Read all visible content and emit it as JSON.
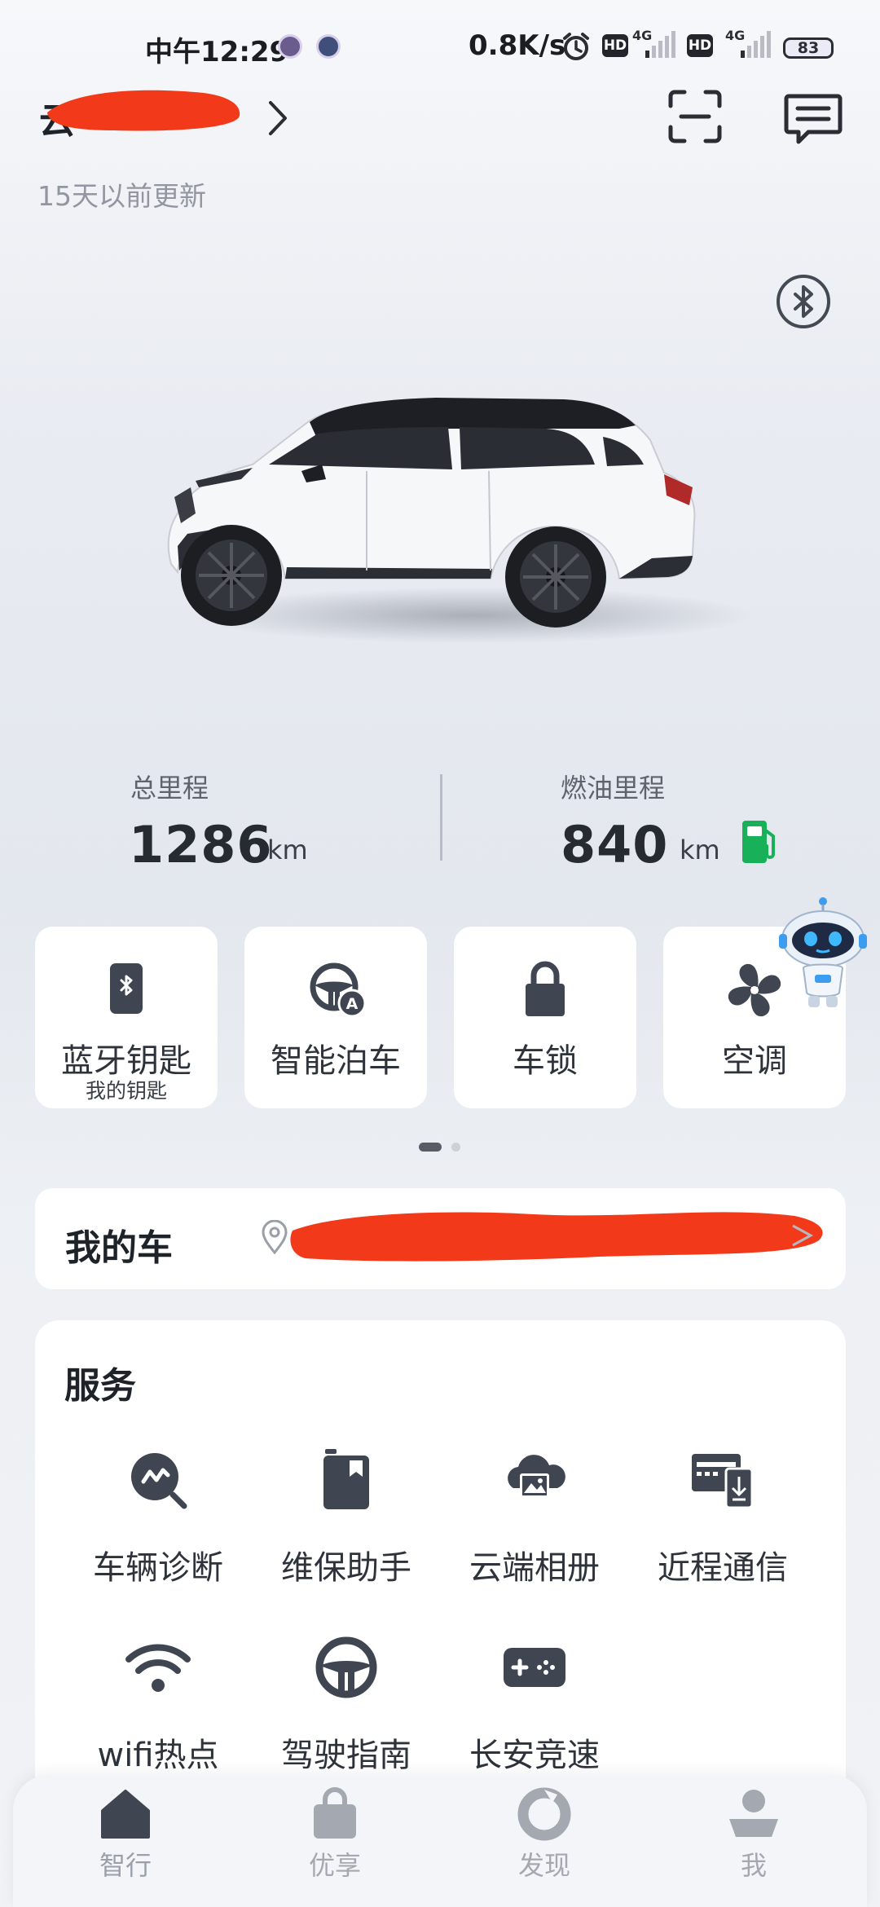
{
  "status_bar": {
    "time": "中午12:29",
    "speed": "0.8K/s",
    "hd1": "HD",
    "net1": "4G",
    "hd2": "HD",
    "net2": "4G",
    "battery": "83"
  },
  "header": {
    "car_name": "云",
    "updated": "15天以前更新"
  },
  "stats": {
    "total_label": "总里程",
    "total_value": "1286",
    "total_unit": "km",
    "fuel_label": "燃油里程",
    "fuel_value": "840",
    "fuel_unit": "km"
  },
  "quick_actions": [
    {
      "label": "蓝牙钥匙",
      "sub": "我的钥匙",
      "icon": "bluetooth-key-icon"
    },
    {
      "label": "智能泊车",
      "sub": "",
      "icon": "auto-parking-icon"
    },
    {
      "label": "车锁",
      "sub": "",
      "icon": "lock-icon"
    },
    {
      "label": "空调",
      "sub": "",
      "icon": "fan-icon"
    }
  ],
  "pager": {
    "count": 2,
    "active": 0
  },
  "my_car": {
    "title": "我的车"
  },
  "services": {
    "title": "服务",
    "items": [
      {
        "label": "车辆诊断",
        "icon": "diagnosis-icon"
      },
      {
        "label": "维保助手",
        "icon": "maintenance-icon"
      },
      {
        "label": "云端相册",
        "icon": "cloud-album-icon"
      },
      {
        "label": "近程通信",
        "icon": "near-communication-icon"
      },
      {
        "label": "wifi热点",
        "icon": "wifi-icon"
      },
      {
        "label": "驾驶指南",
        "icon": "steering-wheel-icon"
      },
      {
        "label": "长安竞速",
        "icon": "gamepad-icon"
      }
    ]
  },
  "bottom_nav": [
    {
      "label": "智行",
      "icon": "home-icon",
      "active": true
    },
    {
      "label": "优享",
      "icon": "shopping-bag-icon",
      "active": false
    },
    {
      "label": "发现",
      "icon": "discover-icon",
      "active": false
    },
    {
      "label": "我",
      "icon": "profile-icon",
      "active": false
    }
  ],
  "colors": {
    "accent_dark": "#3f4651",
    "inactive": "#a3a8b1",
    "fuel_green": "#18b15a",
    "redaction": "#f23a1a"
  }
}
